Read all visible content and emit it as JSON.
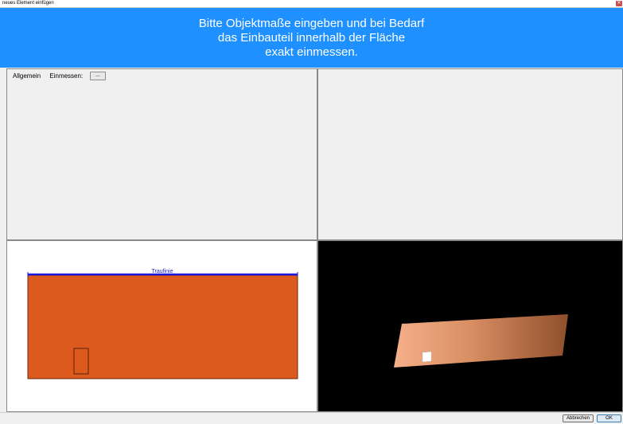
{
  "window": {
    "title": "neues Element einfügen"
  },
  "banner": {
    "line1": "Bitte Objektmaße eingeben und bei Bedarf",
    "line2": "das Einbauteil innerhalb der Fläche",
    "line3": "exakt einmessen."
  },
  "tabs": {
    "general": "Allgemein",
    "measure": "Einmessen:",
    "measure_button": "..."
  },
  "view2d": {
    "eave_label": "Traufinie",
    "surface_color": "#dc5a1e",
    "eave_color": "#1a1adf"
  },
  "buttons": {
    "cancel": "Abbrechen",
    "ok": "OK"
  },
  "colors": {
    "banner": "#1e90ff"
  }
}
